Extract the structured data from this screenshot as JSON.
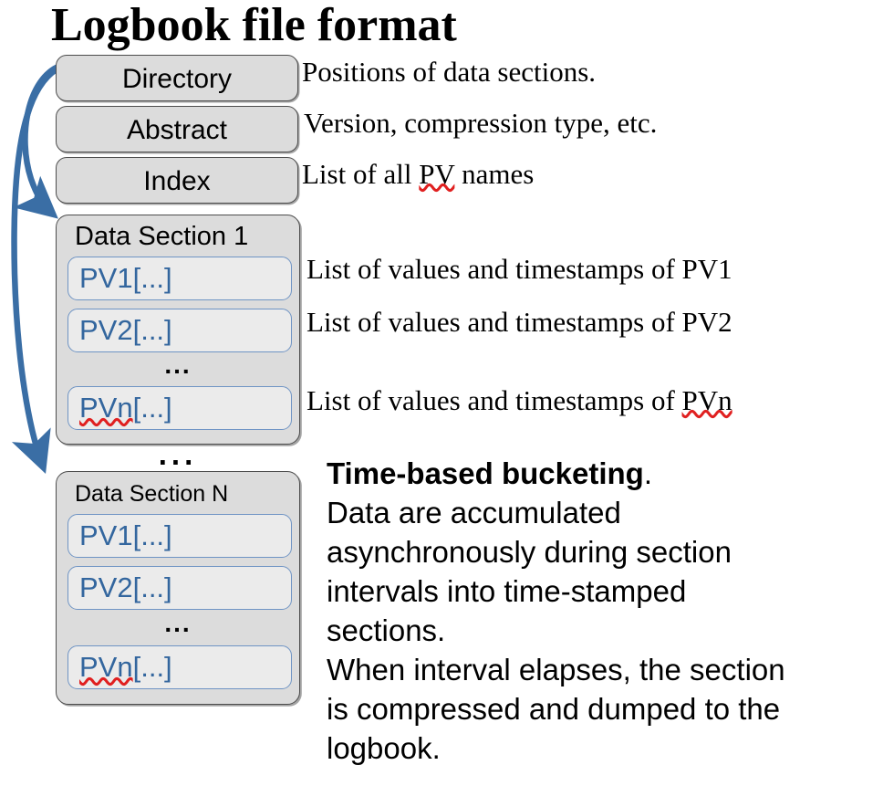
{
  "title": "Logbook file format",
  "colors": {
    "arrow": "#3a6ea5",
    "box_fill": "#dcdcdc",
    "box_border": "#4d4d4d",
    "pv_fill": "#ebebeb",
    "pv_border": "#6f94c4",
    "pv_text": "#33669e",
    "spellcheck_underline": "#e02020",
    "text": "#000000",
    "background": "#ffffff"
  },
  "header_boxes": [
    {
      "label": "Directory",
      "description": "Positions of data sections."
    },
    {
      "label": "Abstract",
      "description": "Version, compression type, etc."
    },
    {
      "label": "Index",
      "description": "List of all PV names",
      "description_pre": "List of all ",
      "description_squiggle": "PV",
      "description_post": " names"
    }
  ],
  "ellipsis": {
    "inner": "...",
    "between_sections": "..."
  },
  "sections": [
    {
      "title": "Data Section 1",
      "entries": [
        {
          "label": "PV1[...]",
          "description": "List of values and timestamps of PV1"
        },
        {
          "label": "PV2[...]",
          "description": "List of values and timestamps of PV2"
        },
        {
          "label_squiggle": "PVn",
          "label_post": "[...]",
          "label": "PVn[...]",
          "description_pre": "List of values and timestamps of ",
          "description_squiggle": "PVn",
          "description": "List of values and timestamps of PVn"
        }
      ]
    },
    {
      "title": "Data Section N",
      "entries": [
        {
          "label": "PV1[...]"
        },
        {
          "label": "PV2[...]"
        },
        {
          "label_squiggle": "PVn",
          "label_post": "[...]",
          "label": "PVn[...]"
        }
      ]
    }
  ],
  "paragraph": {
    "lead": "Time-based bucketing",
    "lead_suffix": ".",
    "lines": [
      "Data are accumulated",
      "asynchronously during section",
      "intervals into time-stamped",
      "sections.",
      "When interval elapses, the section",
      "is compressed and dumped to the",
      "logbook."
    ]
  },
  "arrows": [
    {
      "name": "directory-to-section-1",
      "from": "Directory",
      "to": "Data Section 1"
    },
    {
      "name": "directory-to-section-n",
      "from": "Directory",
      "to": "Data Section N"
    }
  ]
}
